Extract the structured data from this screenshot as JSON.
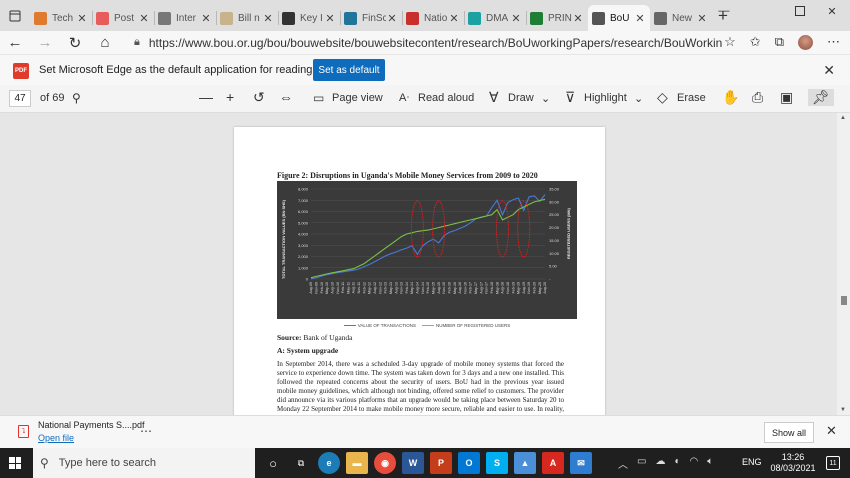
{
  "tabs": [
    {
      "label": "Tech",
      "color": "#e07a2f"
    },
    {
      "label": "Post",
      "color": "#e85c5c"
    },
    {
      "label": "Inter",
      "color": "#777777"
    },
    {
      "label": "Bill n",
      "color": "#c8b48a"
    },
    {
      "label": "Key I",
      "color": "#333333"
    },
    {
      "label": "FinSc",
      "color": "#21759b"
    },
    {
      "label": "Natio",
      "color": "#c9302c"
    },
    {
      "label": "DMA",
      "color": "#1ba1a1"
    },
    {
      "label": "PRIN",
      "color": "#1e7e34"
    },
    {
      "label": "BoU",
      "color": "#555555",
      "active": true
    },
    {
      "label": "New",
      "color": "#666666"
    }
  ],
  "address": {
    "url": "https://www.bou.or.ug/bou/bouwebsite/bouwebsitecontent/research/BoUworkingPapers/research/BouWorking..."
  },
  "infobar": {
    "message": "Set Microsoft Edge as the default application for reading PDF files?",
    "button": "Set as default",
    "pdf_badge": "PDF"
  },
  "pdf_toolbar": {
    "page": "47",
    "of": "of 69",
    "page_view": "Page view",
    "read_aloud": "Read aloud",
    "draw": "Draw",
    "highlight": "Highlight",
    "erase": "Erase"
  },
  "document": {
    "figure_title": "Figure 2: Disruptions in Uganda's Mobile Money Services from 2009 to 2020",
    "source_label": "Source:",
    "source_text": " Bank of Uganda",
    "section": "A: System upgrade",
    "paragraph": "In September 2014, there was a scheduled 3-day upgrade of mobile money systems that forced the service to experience down time. The system was taken down for 3 days and a new one installed. This followed the repeated concerns about the security of users. BoU had in the previous year issued mobile money guidelines, which although not binding, offered some relief to customers. The provider did announce via its various platforms that an upgrade would be taking place between Saturday 20 to Monday 22 September 2014 to make mobile money more secure, reliable and easier to use. In reality, the down time went on for a total of 5 days."
  },
  "chart_data": {
    "type": "line",
    "title": "Figure 2: Disruptions in Uganda's Mobile Money Services from 2009 to 2020",
    "ylabel": "TOTAL TRANSACTION VALUES (BN SHS)",
    "y2label": "REGISTERED USERS (MN)",
    "ylim": [
      0,
      8000
    ],
    "y2lim": [
      0,
      35
    ],
    "yticks": [
      "0",
      "1,000",
      "2,000",
      "3,000",
      "4,000",
      "5,000",
      "6,000",
      "7,000",
      "8,000"
    ],
    "y2ticks": [
      "-",
      "5.00",
      "10.00",
      "15.00",
      "20.00",
      "25.00",
      "30.00",
      "35.00"
    ],
    "x": [
      "Aug-09",
      "Nov-09",
      "Feb-10",
      "May-10",
      "Aug-10",
      "Nov-10",
      "Feb-11",
      "May-11",
      "Aug-11",
      "Nov-11",
      "Feb-12",
      "May-12",
      "Aug-12",
      "Nov-12",
      "Feb-13",
      "May-13",
      "Aug-13",
      "Nov-13",
      "Feb-14",
      "May-14",
      "Aug-14",
      "Nov-14",
      "Feb-15",
      "May-15",
      "Aug-15",
      "Nov-15",
      "Feb-16",
      "May-16",
      "Aug-16",
      "Nov-16",
      "Feb-17",
      "May-17",
      "Aug-17",
      "Nov-17",
      "Feb-18",
      "May-18",
      "Aug-18",
      "Nov-18",
      "Feb-19",
      "May-19",
      "Aug-19",
      "Nov-19",
      "Feb-20",
      "May-20",
      "Aug-20"
    ],
    "series": [
      {
        "name": "VALUE OF TRANSACTIONS",
        "color": "#4a78d6",
        "axis": "left",
        "values": [
          20,
          120,
          260,
          380,
          480,
          560,
          640,
          700,
          780,
          900,
          1100,
          1300,
          1550,
          1800,
          2050,
          2250,
          2400,
          2600,
          2750,
          2950,
          2200,
          2950,
          3300,
          3550,
          3200,
          3850,
          4150,
          4300,
          4500,
          4700,
          5000,
          5350,
          5500,
          5600,
          6350,
          7000,
          5700,
          6800,
          7050,
          7200,
          6100,
          7300,
          7400,
          6900,
          7500
        ]
      },
      {
        "name": "NUMBER OF REGISTERED USERS",
        "color": "#7bc142",
        "axis": "right",
        "values": [
          0.5,
          1.0,
          1.5,
          2.0,
          2.4,
          2.8,
          3.2,
          3.6,
          4.0,
          5.0,
          6.0,
          7.5,
          9.0,
          10.5,
          12.0,
          13.5,
          15.0,
          16.5,
          17.5,
          18.0,
          18.5,
          18.8,
          19.0,
          19.5,
          20.0,
          20.5,
          21.0,
          21.5,
          22.0,
          22.5,
          23.0,
          23.5,
          24.0,
          24.5,
          25.0,
          27.0,
          23.0,
          24.0,
          25.0,
          27.0,
          28.0,
          29.0,
          30.0,
          30.5,
          31.0
        ]
      }
    ],
    "disruptions": [
      20,
      24,
      36,
      40
    ],
    "legend_position": "bottom",
    "grid": true
  },
  "downloads": {
    "file": "National Payments S....pdf",
    "open": "Open file",
    "show_all": "Show all"
  },
  "taskbar": {
    "search_placeholder": "Type here to search",
    "lang": "ENG",
    "time": "13:26",
    "date": "08/03/2021",
    "notifications": "11"
  }
}
